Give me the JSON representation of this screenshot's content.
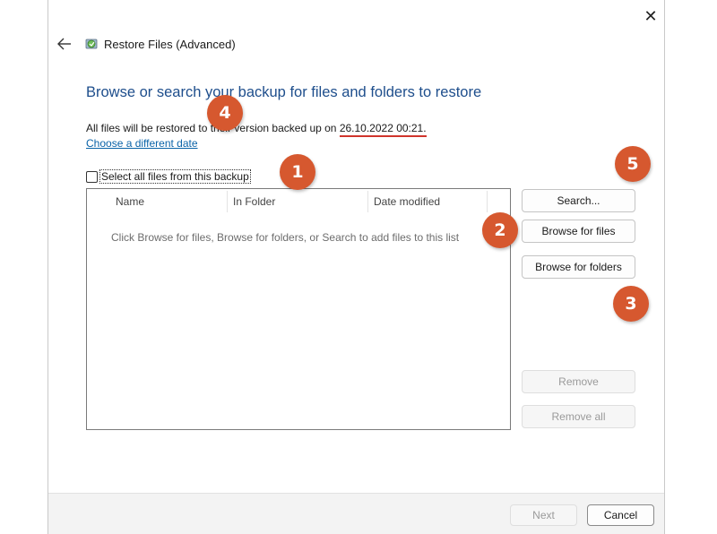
{
  "window": {
    "title": "Restore Files (Advanced)",
    "close_glyph": "✕"
  },
  "main": {
    "heading": "Browse or search your backup for files and folders to restore",
    "info_prefix": "All files will be restored to their version backed up on ",
    "info_date": "26.10.2022 00:21.",
    "change_date_link": "Choose a different date",
    "select_all_label": "Select all files from this backup",
    "select_all_checked": false,
    "columns": [
      "Name",
      "In Folder",
      "Date modified"
    ],
    "empty_message": "Click Browse for files, Browse for folders, or Search to add files to this list"
  },
  "buttons": {
    "search": "Search...",
    "browse_files": "Browse for files",
    "browse_folders": "Browse for folders",
    "remove": "Remove",
    "remove_all": "Remove all"
  },
  "footer": {
    "next": "Next",
    "cancel": "Cancel"
  },
  "markers": [
    "1",
    "2",
    "3",
    "4",
    "5"
  ],
  "colors": {
    "heading": "#1e4e8c",
    "link": "#0a63a8",
    "marker": "#d6582f",
    "date_underline": "#d0342c"
  }
}
